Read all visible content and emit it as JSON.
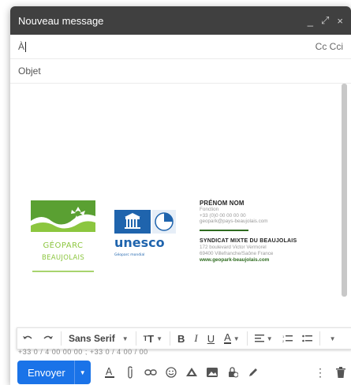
{
  "window": {
    "title": "Nouveau message",
    "controls": [
      "_",
      "⤢",
      "×"
    ]
  },
  "to": {
    "label": "À",
    "value": "",
    "cc_bcc": "Cc Cci"
  },
  "subject": {
    "placeholder": "Objet",
    "value": ""
  },
  "signature": {
    "logo_geoparc": {
      "line1": "GÉOPARC",
      "line2": "BEAUJOLAIS"
    },
    "logo_unesco": {
      "word": "unesco",
      "sub": "Géoparc mondial"
    },
    "person": {
      "name": "PRÉNOM NOM",
      "function": "Fonction",
      "phone": "+33 (0)0 00 00 00 00",
      "email": "geopark@pays-beaujolais.com"
    },
    "org": {
      "name": "SYNDICAT MIXTE DU BEAUJOLAIS",
      "address1": "172 boulevard Victor Vermorel",
      "address2": "69400 Villefranche/Saône France",
      "url": "www.geopark-beaujolais.com"
    }
  },
  "format_bar": {
    "font": "Sans Serif",
    "undo_icon": "undo-icon",
    "redo_icon": "redo-icon"
  },
  "ghost_text": "+33 0 / 4 00 00 00 ; +33 0 / 4 00 / 00",
  "send": {
    "label": "Envoyer"
  },
  "colors": {
    "primary": "#1a73e8",
    "titlebar": "#404040",
    "geoparc_green": "#5aa032",
    "unesco_blue": "#1f64ad"
  }
}
